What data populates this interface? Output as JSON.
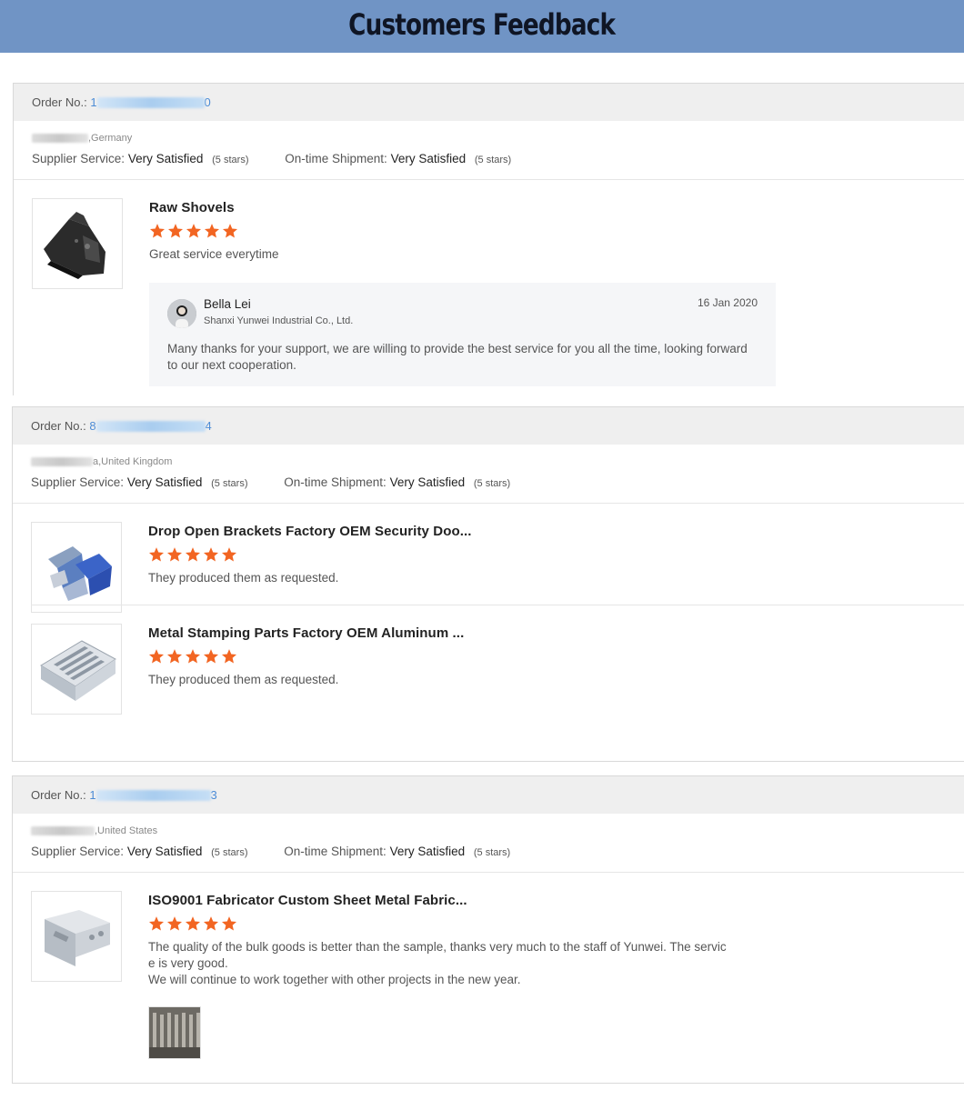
{
  "banner": {
    "title": "Customers Feedback"
  },
  "orders": [
    {
      "order_label": "Order No.:",
      "order_prefix": "1",
      "order_suffix": "0",
      "buyer_location": ",Germany",
      "supplier_service_label": "Supplier Service:",
      "supplier_service_value": "Very Satisfied",
      "supplier_service_stars": "(5 stars)",
      "shipment_label": "On-time Shipment:",
      "shipment_value": "Very Satisfied",
      "shipment_stars": "(5 stars)",
      "products": [
        {
          "title": "Raw Shovels",
          "rating": 5,
          "comment": "Great service everytime",
          "thumb_icon": "black-metal-bracket-icon"
        }
      ],
      "reply": {
        "name": "Bella Lei",
        "company": "Shanxi Yunwei Industrial Co., Ltd.",
        "date": "16 Jan 2020",
        "text": "Many thanks for your support, we are willing to provide the best service for you all the time, looking forward to our next cooperation."
      }
    },
    {
      "order_label": "Order No.:",
      "order_prefix": "8",
      "order_suffix": "4",
      "buyer_location": "a,United Kingdom",
      "supplier_service_label": "Supplier Service:",
      "supplier_service_value": "Very Satisfied",
      "supplier_service_stars": "(5 stars)",
      "shipment_label": "On-time Shipment:",
      "shipment_value": "Very Satisfied",
      "shipment_stars": "(5 stars)",
      "products": [
        {
          "title": "Drop Open Brackets Factory OEM Security Doo...",
          "rating": 5,
          "comment": "They produced them as requested.",
          "thumb_icon": "blue-brackets-icon"
        },
        {
          "title": "Metal Stamping Parts Factory OEM Aluminum ...",
          "rating": 5,
          "comment": "They produced them as requested.",
          "thumb_icon": "slotted-metal-tray-icon"
        }
      ]
    },
    {
      "order_label": "Order No.:",
      "order_prefix": "1",
      "order_suffix": "3",
      "buyer_location": ",United States",
      "supplier_service_label": "Supplier Service:",
      "supplier_service_value": "Very Satisfied",
      "supplier_service_stars": "(5 stars)",
      "shipment_label": "On-time Shipment:",
      "shipment_value": "Very Satisfied",
      "shipment_stars": "(5 stars)",
      "products": [
        {
          "title": "ISO9001 Fabricator Custom Sheet Metal Fabric...",
          "rating": 5,
          "comment_line1": "The quality of the bulk goods is better than the sample, thanks very much to the staff of Yunwei. The servic",
          "comment_line2": "e is very good.",
          "comment_line3": "We will continue to work together with other projects in the new year.",
          "thumb_icon": "steel-bracket-icon",
          "extra_image_icon": "metal-parts-batch-icon"
        }
      ]
    }
  ],
  "colors": {
    "banner": "#7094c5",
    "star": "#f26522",
    "header_bg": "#efefef"
  }
}
